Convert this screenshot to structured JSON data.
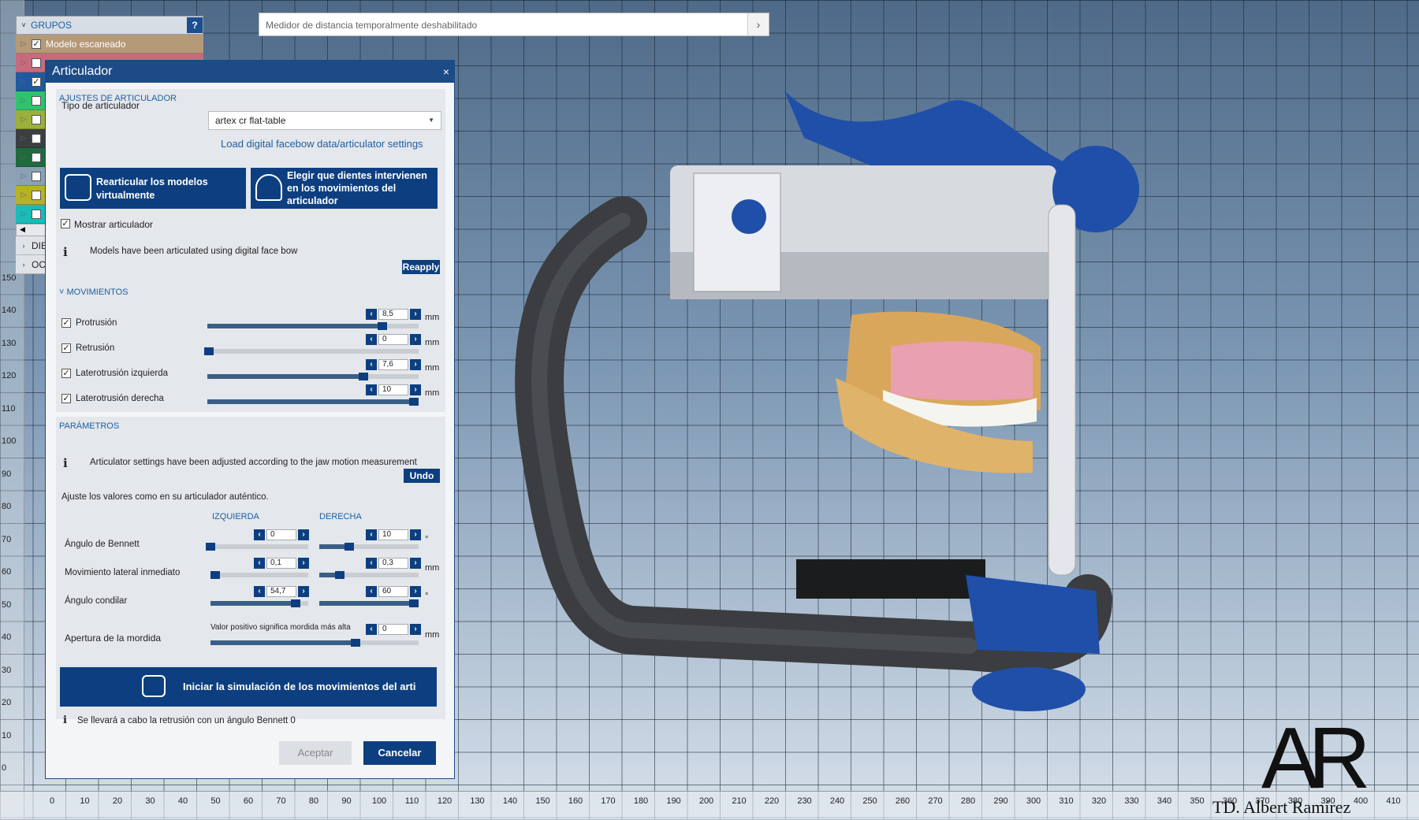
{
  "measure_bar": {
    "text": "Medidor de distancia temporalmente deshabilitado",
    "arrow": "›"
  },
  "groups": {
    "header": "GRUPOS",
    "help": "?",
    "rows": [
      {
        "label": "Modelo escaneado",
        "color": "#b59a78",
        "checked": true
      },
      {
        "label": "",
        "color": "#c86a7e",
        "checked": false
      },
      {
        "label": "",
        "color": "#1f5aa0",
        "checked": true
      },
      {
        "label": "",
        "color": "#2fc36c",
        "checked": false
      },
      {
        "label": "",
        "color": "#9bb03a",
        "checked": false
      },
      {
        "label": "",
        "color": "#3b3f42",
        "checked": false
      },
      {
        "label": "",
        "color": "#1f6b3e",
        "checked": false
      },
      {
        "label": "",
        "color": "#8aa0b5",
        "checked": false
      },
      {
        "label": "",
        "color": "#b7b224",
        "checked": false
      },
      {
        "label": "",
        "color": "#18bcb8",
        "checked": false
      }
    ],
    "extra": [
      "DIE",
      "OC"
    ]
  },
  "dialog": {
    "title": "Articulador",
    "close": "×",
    "settings_header": "AJUSTES DE ARTICULADOR",
    "type_label": "Tipo de articulador",
    "type_value": "artex cr flat-table",
    "load_link": "Load digital facebow data/articulator settings",
    "btn_rearticulate": "Rearticular los modelos virtualmente",
    "btn_teeth": "Elegir que dientes intervienen en los movimientos del articulador",
    "show_articulator": "Mostrar articulador",
    "info_facebow": "Models have been articulated using digital face bow",
    "reapply": "Reapply",
    "movements_header": "MOVIMIENTOS",
    "movements": [
      {
        "label": "Protrusión",
        "value": "8,5",
        "fraction": 0.85
      },
      {
        "label": "Retrusión",
        "value": "0",
        "fraction": 0.03
      },
      {
        "label": "Laterotrusión izquierda",
        "value": "7,6",
        "fraction": 0.76
      },
      {
        "label": "Laterotrusión derecha",
        "value": "10",
        "fraction": 1.0
      }
    ],
    "unit_mm": "mm",
    "params_header": "PARÁMETROS",
    "info_params": "Articulator settings have been adjusted according to the jaw motion measurement",
    "undo": "Undo",
    "hint": "Ajuste los valores como en su articulador auténtico.",
    "col_left": "IZQUIERDA",
    "col_right": "DERECHA",
    "params": [
      {
        "label": "Ángulo de Bennett",
        "left": "0",
        "left_fraction": 0.05,
        "right": "10",
        "right_fraction": 0.35,
        "unit": "°"
      },
      {
        "label": "Movimiento lateral inmediato",
        "left": "0,1",
        "left_fraction": 0.1,
        "right": "0,3",
        "right_fraction": 0.25,
        "unit": "mm"
      },
      {
        "label": "Ángulo condilar",
        "left": "54,7",
        "left_fraction": 0.92,
        "right": "60",
        "right_fraction": 1.0,
        "unit": "°"
      }
    ],
    "bite_label": "Apertura de la mordida",
    "bite_hint": "Valor positivo significa mordida más alta",
    "bite_value": "0",
    "bite_fraction": 0.72,
    "simulate_btn": "Iniciar la simulación de los movimientos del arti",
    "retrusion_note": "Se llevará a cabo la retrusión con un ángulo Bennett 0",
    "accept": "Aceptar",
    "cancel": "Cancelar"
  },
  "ruler_left": [
    "150",
    "140",
    "130",
    "120",
    "110",
    "100",
    "90",
    "80",
    "70",
    "60",
    "50",
    "40",
    "30",
    "20",
    "10",
    "0"
  ],
  "ruler_bottom": [
    "0",
    "10",
    "20",
    "30",
    "40",
    "50",
    "60",
    "70",
    "80",
    "90",
    "100",
    "110",
    "120",
    "130",
    "140",
    "150",
    "160",
    "170",
    "180",
    "190",
    "200",
    "210",
    "220",
    "230",
    "240",
    "250",
    "260",
    "270",
    "280",
    "290",
    "300",
    "310",
    "320",
    "330",
    "340",
    "350",
    "360",
    "370",
    "380",
    "390",
    "400",
    "410"
  ],
  "watermark": {
    "name": "TD. Albert Ramírez",
    "mark": "AR"
  },
  "colors": {
    "accent": "#0d3f80",
    "header_text": "#1b5fa6"
  }
}
